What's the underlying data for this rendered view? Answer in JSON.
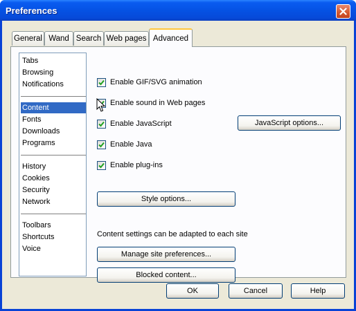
{
  "window": {
    "title": "Preferences",
    "close_icon": "close-icon"
  },
  "tabs": [
    {
      "label": "General",
      "active": false
    },
    {
      "label": "Wand",
      "active": false
    },
    {
      "label": "Search",
      "active": false
    },
    {
      "label": "Web pages",
      "active": false
    },
    {
      "label": "Advanced",
      "active": true
    }
  ],
  "sidebar": {
    "groups": [
      [
        "Tabs",
        "Browsing",
        "Notifications"
      ],
      [
        "Content",
        "Fonts",
        "Downloads",
        "Programs"
      ],
      [
        "History",
        "Cookies",
        "Security",
        "Network"
      ],
      [
        "Toolbars",
        "Shortcuts",
        "Voice"
      ]
    ],
    "selected": "Content"
  },
  "content": {
    "checkboxes": [
      {
        "label": "Enable GIF/SVG animation",
        "checked": true
      },
      {
        "label": "Enable sound in Web pages",
        "checked": true
      },
      {
        "label": "Enable JavaScript",
        "checked": true
      },
      {
        "label": "Enable Java",
        "checked": true
      },
      {
        "label": "Enable plug-ins",
        "checked": true
      }
    ],
    "javascript_options_label": "JavaScript options...",
    "style_options_label": "Style options...",
    "site_info_text": "Content settings can be adapted to each site",
    "manage_site_prefs_label": "Manage site preferences...",
    "blocked_content_label": "Blocked content..."
  },
  "footer": {
    "ok_label": "OK",
    "cancel_label": "Cancel",
    "help_label": "Help"
  },
  "colors": {
    "titlebar": "#0552e4",
    "selection": "#316ac5",
    "checkmark": "#21a121",
    "active_tab_accent": "#ffc73c"
  }
}
